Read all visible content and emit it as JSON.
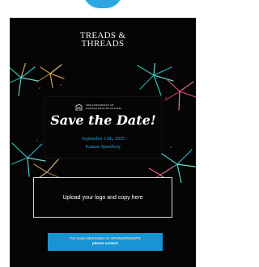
{
  "brand": {
    "line1": "TREADS &",
    "line2": "THREADS"
  },
  "save_panel": {
    "logo_line1": "THE UNIVERSITY OF",
    "logo_line2": "KANSAS HEALTH SYSTEM",
    "title": "Save the Date!",
    "date": "September 13th, 2025",
    "location": "Kansas Speedway"
  },
  "upload": {
    "label": "Upload your logo and copy here"
  },
  "cta": {
    "line1": "For more information on SPONSORSHIPS",
    "line2": "please contact"
  },
  "colors": {
    "accent_blue": "#1795d3",
    "date_blue": "#1ea8df",
    "background": "#050505"
  },
  "icons": {
    "logo": "hotel-logo-icon",
    "decor": "fireworks-illustration"
  }
}
